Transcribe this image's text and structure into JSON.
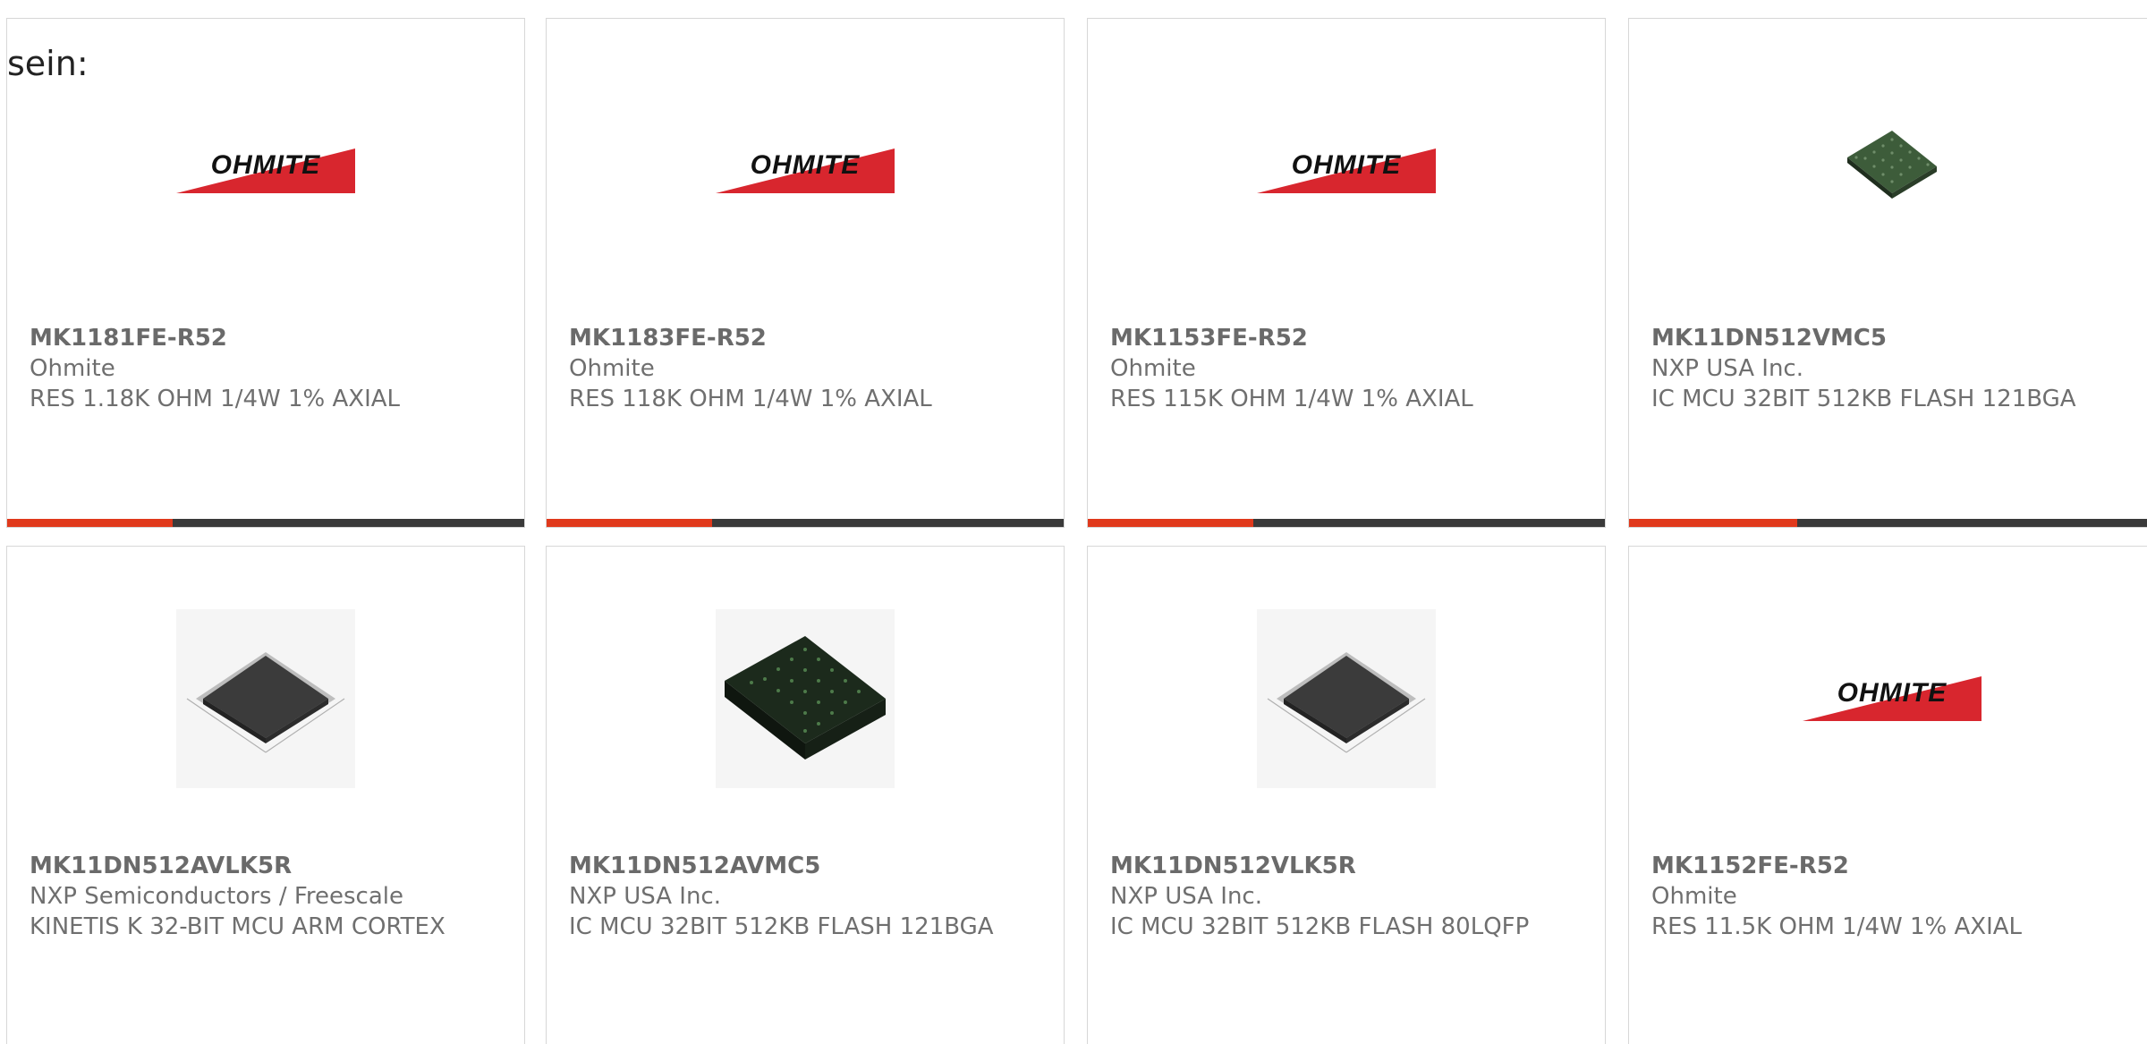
{
  "intro_text": "sein:",
  "cards": [
    {
      "part_number": "MK1181FE-R52",
      "manufacturer": "Ohmite",
      "description": "RES 1.18K OHM 1/4W 1% AXIAL",
      "image": "ohmite-logo",
      "logo_text": "OHMITE",
      "progress": 0.32
    },
    {
      "part_number": "MK1183FE-R52",
      "manufacturer": "Ohmite",
      "description": "RES 118K OHM 1/4W 1% AXIAL",
      "image": "ohmite-logo",
      "logo_text": "OHMITE",
      "progress": 0.32
    },
    {
      "part_number": "MK1153FE-R52",
      "manufacturer": "Ohmite",
      "description": "RES 115K OHM 1/4W 1% AXIAL",
      "image": "ohmite-logo",
      "logo_text": "OHMITE",
      "progress": 0.32
    },
    {
      "part_number": "MK11DN512VMC5",
      "manufacturer": "NXP USA Inc.",
      "description": "IC MCU 32BIT 512KB FLASH 121BGA",
      "image": "bga-chip-small",
      "progress": 0.32
    },
    {
      "part_number": "MK11DN512AVLK5R",
      "manufacturer": "NXP Semiconductors / Freescale",
      "description": "KINETIS K 32-BIT MCU ARM CORTEX",
      "image": "lqfp-chip"
    },
    {
      "part_number": "MK11DN512AVMC5",
      "manufacturer": "NXP USA Inc.",
      "description": "IC MCU 32BIT 512KB FLASH 121BGA",
      "image": "bga-chip-large"
    },
    {
      "part_number": "MK11DN512VLK5R",
      "manufacturer": "NXP USA Inc.",
      "description": "IC MCU 32BIT 512KB FLASH 80LQFP",
      "image": "lqfp-chip"
    },
    {
      "part_number": "MK1152FE-R52",
      "manufacturer": "Ohmite",
      "description": "RES 11.5K OHM 1/4W 1% AXIAL",
      "image": "ohmite-logo",
      "logo_text": "OHMITE"
    }
  ],
  "colors": {
    "accent": "#e0391c",
    "bar_track": "#3a3a3a",
    "logo_red": "#d8262e",
    "chip_green": "#3d5c3a",
    "chip_dark": "#3a3a3a"
  }
}
